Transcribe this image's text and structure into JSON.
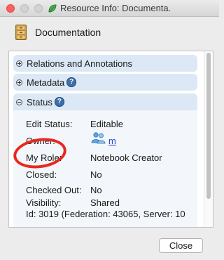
{
  "window": {
    "title": "Resource Info: Documenta."
  },
  "header": {
    "title": "Documentation",
    "icon": "cabinet-icon"
  },
  "sections": [
    {
      "label": "Relations and Annotations",
      "expanded": false
    },
    {
      "label": "Metadata",
      "expanded": false,
      "has_help": true
    },
    {
      "label": "Status",
      "expanded": true,
      "has_help": true
    }
  ],
  "help_glyph": "?",
  "status": {
    "rows": [
      {
        "label": "Edit Status:",
        "value": "Editable"
      },
      {
        "label": "Owner:",
        "value": "m",
        "icon": "users-icon"
      },
      {
        "label": "My Role:",
        "value": "Notebook Creator"
      },
      {
        "label": "Closed:",
        "value": "No"
      },
      {
        "label": "Checked Out:",
        "value": "No"
      },
      {
        "label": "Visibility:",
        "value": "Shared"
      }
    ],
    "id_line": "Id: 3019 (Federation: 43065, Server: 10"
  },
  "buttons": {
    "close": "Close"
  },
  "colors": {
    "section_bg": "#dce8f5",
    "help_icon": "#3d6fa8",
    "link": "#1f4fd0",
    "annotation_oval": "#e8281e",
    "close_light": "#fc605c"
  }
}
